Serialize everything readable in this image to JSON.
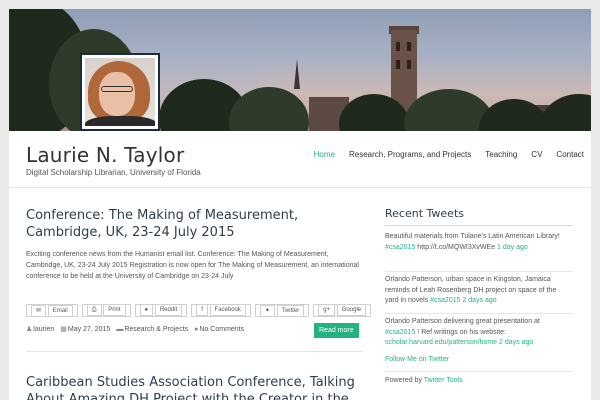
{
  "site": {
    "title": "Laurie N. Taylor",
    "description": "Digital Scholarship Librarian, University of Florida"
  },
  "nav": {
    "items": [
      {
        "label": "Home",
        "active": true
      },
      {
        "label": "Research, Programs, and Projects",
        "active": false
      },
      {
        "label": "Teaching",
        "active": false
      },
      {
        "label": "CV",
        "active": false
      },
      {
        "label": "Contact",
        "active": false
      }
    ]
  },
  "colors": {
    "accent": "#23b37f",
    "title": "#2d3e50"
  },
  "post": {
    "title": "Conference: The Making of Measurement, Cambridge, UK, 23-24 July 2015",
    "excerpt": "Exciting conference news from the Humanist email list. Conference: The Making of Measurement, Cambridge, UK, 23-24 July 2015 Registration is now open for The Making of Measurement, an international conference to be held at the University of Cambridge on 23-24 July",
    "share": {
      "email": "Email",
      "print": "Print",
      "reddit": "Reddit",
      "facebook": "Facebook",
      "twitter": "Twitter",
      "google": "Google"
    },
    "meta": {
      "author": "laurien",
      "date": "May 27, 2015",
      "category": "Research & Projects",
      "comments": "No Comments"
    },
    "read_more": "Read more"
  },
  "post2": {
    "title": "Caribbean Studies Association Conference, Talking About Amazing DH Project with the Creator in the"
  },
  "sidebar": {
    "title": "Recent Tweets",
    "tweets": [
      {
        "text": "Beautiful materials from Tulane's Latin American Library! ",
        "tag": "#csa2015",
        "text2": " http://t.co/MQWI3XvWEe ",
        "time": "1 day ago"
      },
      {
        "text": "Orlando Patterson, urban space in Kingston, Jamaica reminds of Leah Rosenberg DH project on space of the yard in novels ",
        "tag": "#csa2015",
        "time": "2 days ago"
      },
      {
        "text": "Orlando Patterson delivering great presentation at ",
        "tag": "#csa2015",
        "text2": " ! Ref writings on his website: ",
        "link": "scholar.harvard.edu/patterson/home",
        "time": "2 days ago"
      }
    ],
    "follow": "Follow Me on Twitter",
    "powered_prefix": "Powered by ",
    "powered_link": "Twitter Tools"
  }
}
